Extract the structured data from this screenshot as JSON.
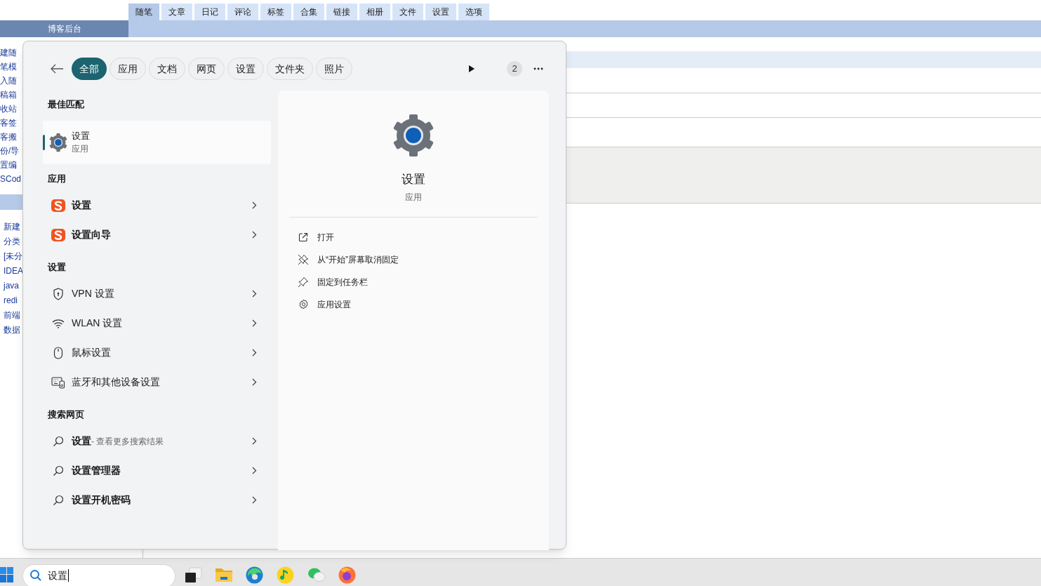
{
  "blog_tabs": [
    {
      "label": "随笔",
      "selected": true
    },
    {
      "label": "文章",
      "selected": false
    },
    {
      "label": "日记",
      "selected": false
    },
    {
      "label": "评论",
      "selected": false
    },
    {
      "label": "标签",
      "selected": false
    },
    {
      "label": "合集",
      "selected": false
    },
    {
      "label": "链接",
      "selected": false
    },
    {
      "label": "相册",
      "selected": false
    },
    {
      "label": "文件",
      "selected": false
    },
    {
      "label": "设置",
      "selected": false
    },
    {
      "label": "选项",
      "selected": false
    }
  ],
  "blog_header": {
    "title": "博客后台"
  },
  "blog_sidebar": {
    "items": [
      "建随",
      "笔模",
      "入随",
      "稿箱",
      "收站",
      "客签",
      "客搬",
      "份/导",
      "置编",
      "SCod"
    ],
    "category_items": [
      "新建",
      "分类",
      "[未分",
      "IDEA",
      "java",
      "redi",
      "前端",
      "数据"
    ]
  },
  "search_panel": {
    "filters": [
      {
        "label": "全部",
        "selected": true
      },
      {
        "label": "应用",
        "selected": false
      },
      {
        "label": "文档",
        "selected": false
      },
      {
        "label": "网页",
        "selected": false
      },
      {
        "label": "设置",
        "selected": false
      },
      {
        "label": "文件夹",
        "selected": false
      },
      {
        "label": "照片",
        "selected": false
      }
    ],
    "badge": "2",
    "best_match": {
      "heading": "最佳匹配",
      "title": "设置",
      "subtitle": "应用",
      "selected": true
    },
    "sections": [
      {
        "heading": "应用",
        "items": [
          {
            "kind": "sogou",
            "label": "设置"
          },
          {
            "kind": "sogou",
            "label": "设置向导"
          }
        ]
      },
      {
        "heading": "设置",
        "items": [
          {
            "kind": "shield",
            "label": "VPN 设置"
          },
          {
            "kind": "wifi",
            "label": "WLAN 设置"
          },
          {
            "kind": "mouse",
            "label": "鼠标设置"
          },
          {
            "kind": "devices",
            "label": "蓝牙和其他设备设置"
          }
        ]
      },
      {
        "heading": "搜索网页",
        "items": [
          {
            "kind": "web",
            "label": "设置",
            "suffix": " - 查看更多搜索结果"
          },
          {
            "kind": "web",
            "label": "设置管理器"
          },
          {
            "kind": "web",
            "label": "设置开机密码"
          }
        ]
      }
    ],
    "details": {
      "title": "设置",
      "subtitle": "应用",
      "actions": [
        {
          "kind": "open",
          "label": "打开"
        },
        {
          "kind": "unpin",
          "label": "从“开始”屏幕取消固定"
        },
        {
          "kind": "pin",
          "label": "固定到任务栏"
        },
        {
          "kind": "gear",
          "label": "应用设置"
        }
      ]
    }
  },
  "taskbar": {
    "search_value": "设置"
  }
}
